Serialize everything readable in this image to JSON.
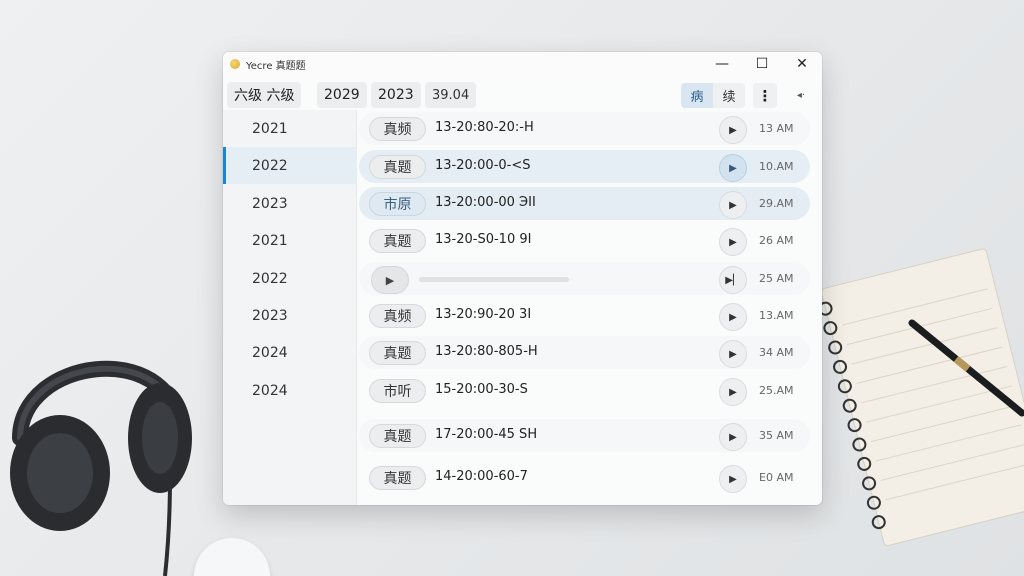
{
  "window": {
    "title": "Yecre 真题题"
  },
  "toolbar": {
    "chips": [
      "六级 六级",
      "2029",
      "2023",
      "39.04"
    ],
    "segment": [
      "病",
      "续"
    ],
    "more_icon": "⋮",
    "back_icon": "◂·"
  },
  "sidebar": {
    "items": [
      "2021",
      "2022",
      "2023",
      "2021",
      "2022",
      "2023",
      "2024",
      "2024"
    ],
    "active_index": 1
  },
  "list": {
    "rows": [
      {
        "tag": "真频",
        "code": "13-20:80-20:-H",
        "time": "13 AM"
      },
      {
        "tag": "真题",
        "code": "13-20:00-0-<S",
        "time": "10.AM"
      },
      {
        "tag": "市原",
        "code": "13-20:00-00 ЭII",
        "time": "29.AM"
      },
      {
        "tag": "真题",
        "code": "13-20-S0-10 9I",
        "time": "26 AM"
      },
      {
        "tag": "",
        "code": "",
        "time": "25 AM"
      },
      {
        "tag": "真频",
        "code": "13-20:90-20 3I",
        "time": "13.AM"
      },
      {
        "tag": "真题",
        "code": "13-20:80-805-H",
        "time": "34 AM"
      },
      {
        "tag": "市听",
        "code": "15-20:00-30-S",
        "time": "25.AM"
      },
      {
        "tag": "真题",
        "code": "17-20:00-45 SH",
        "time": "35 AM"
      },
      {
        "tag": "真题",
        "code": "14-20:00-60-7",
        "time": "E0 AM"
      }
    ],
    "player_progress": 0.0
  },
  "icons": {
    "play": "▶",
    "next": "▶▏"
  },
  "colors": {
    "accent": "#1a86d0",
    "selected_row": "#e5eef5"
  }
}
